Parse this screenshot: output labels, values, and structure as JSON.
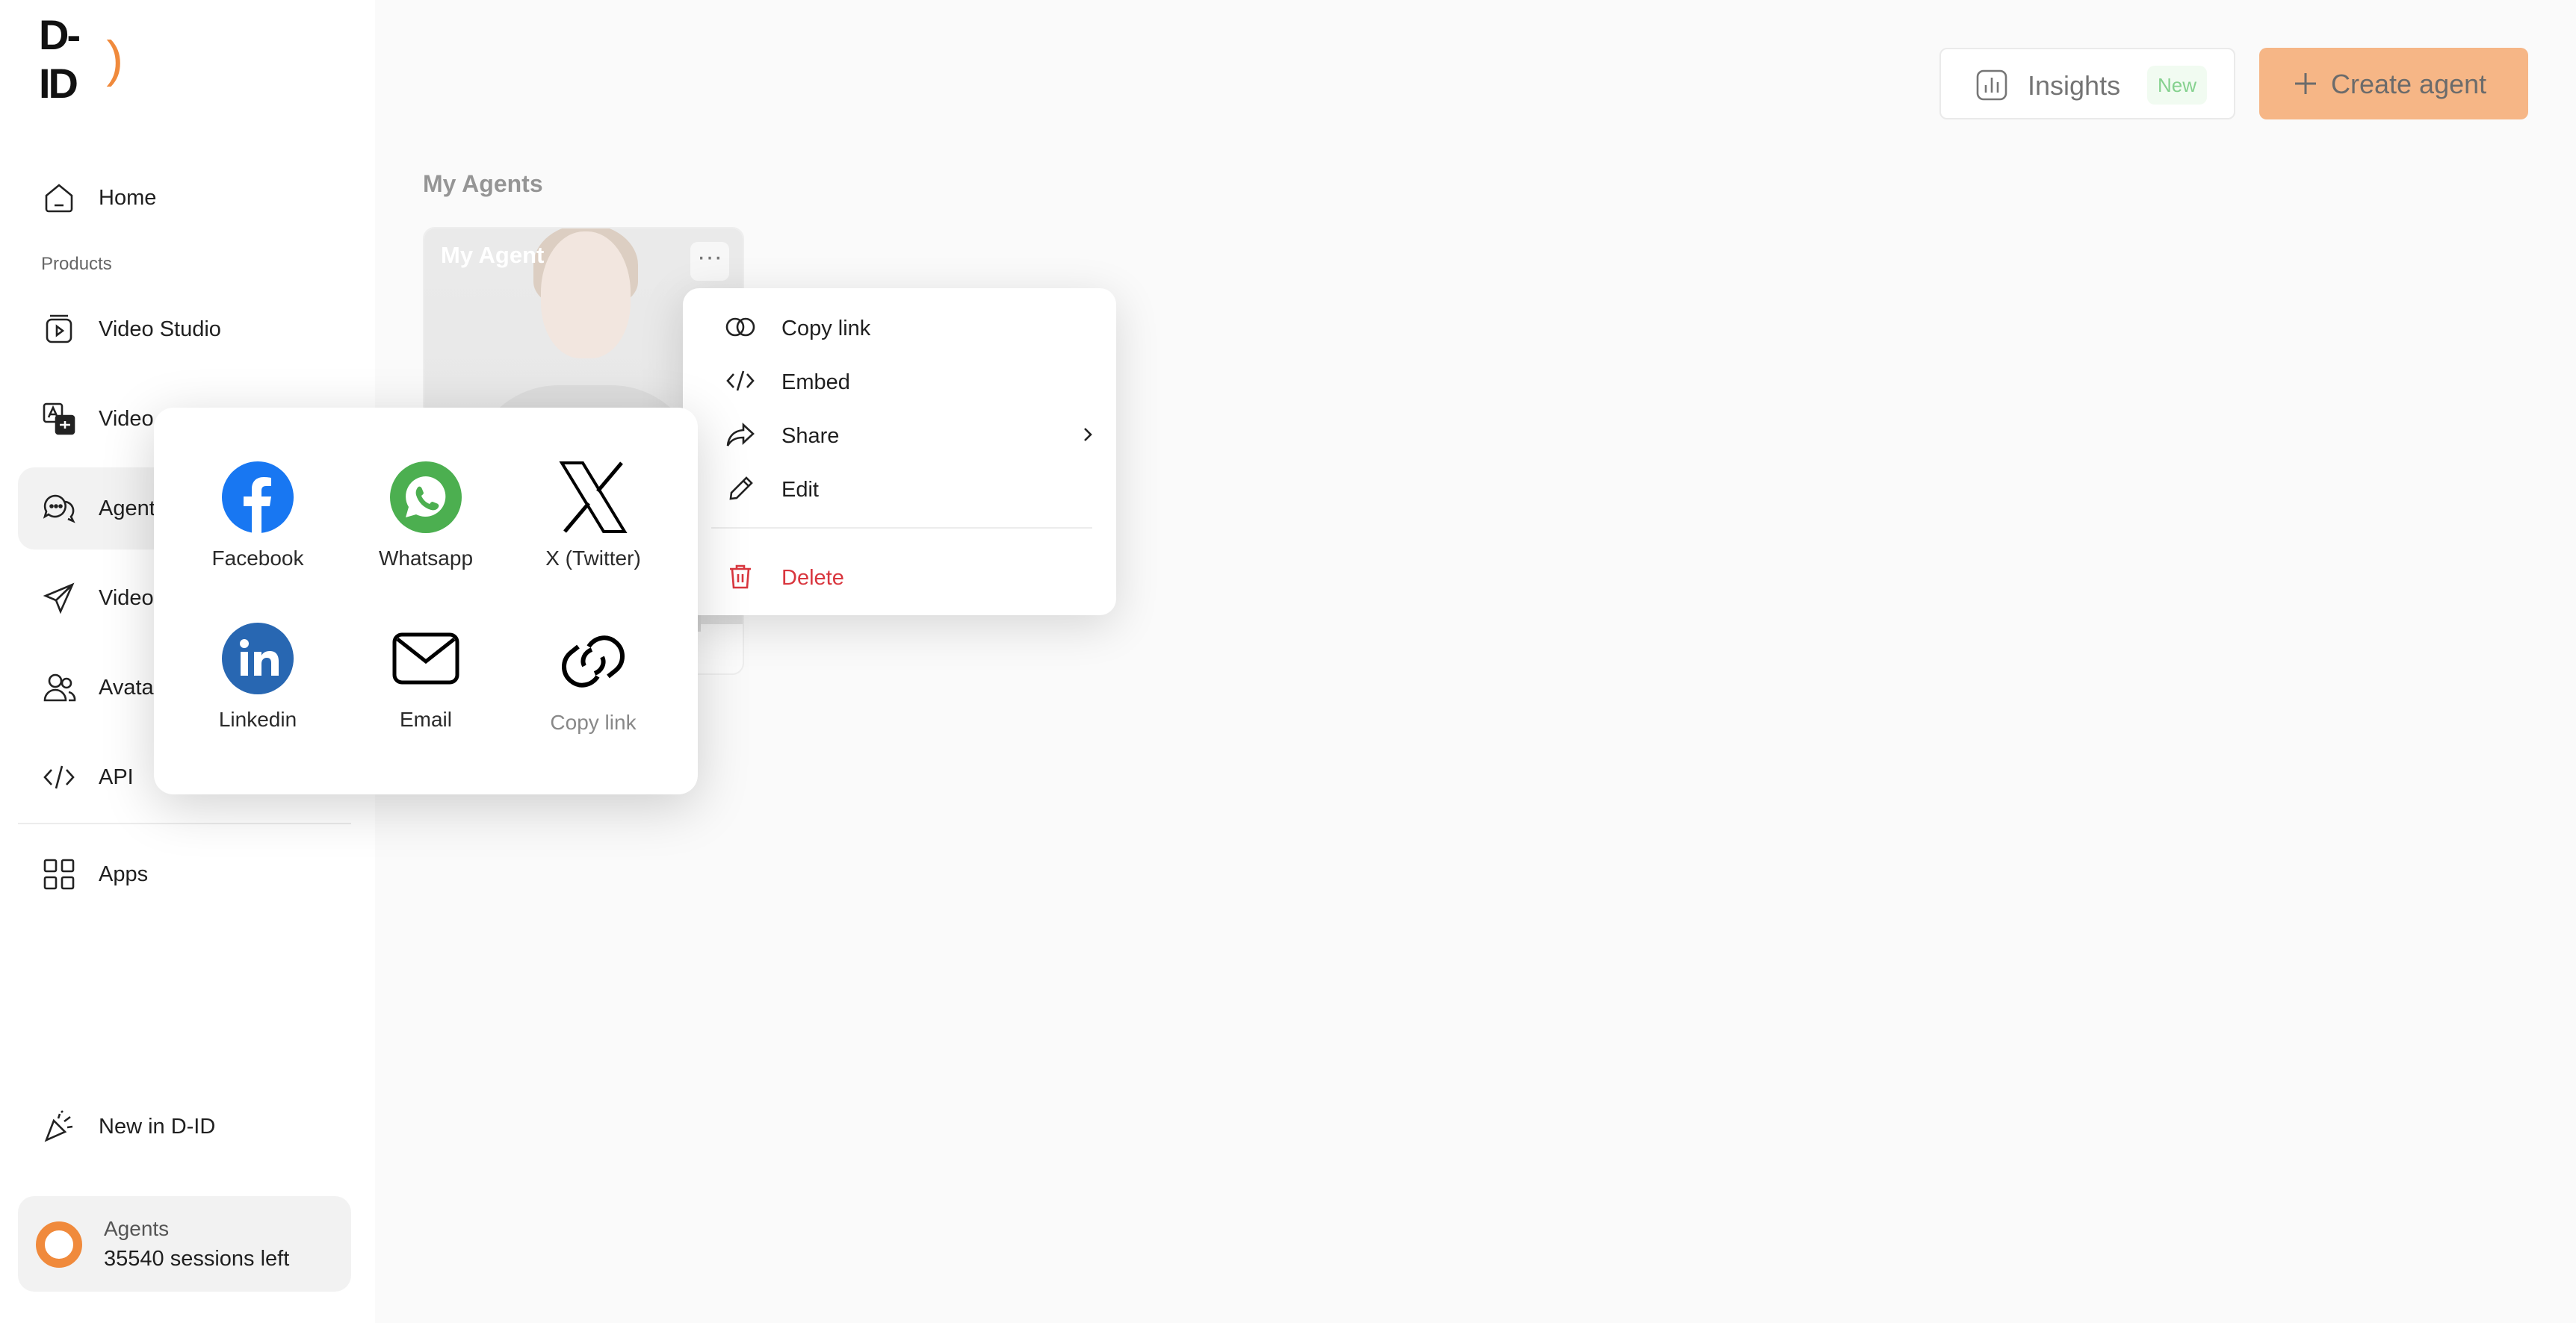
{
  "brand": {
    "logo_main": "D-ID",
    "logo_accent": ")",
    "accent_color": "#f08a3c"
  },
  "sidebar": {
    "home": "Home",
    "section_products": "Products",
    "items": [
      {
        "label": "Video Studio",
        "icon": "video-studio-icon"
      },
      {
        "label": "Video",
        "icon": "video-translate-icon"
      },
      {
        "label": "Agent",
        "icon": "agents-chat-icon"
      },
      {
        "label": "Video",
        "icon": "send-video-icon"
      },
      {
        "label": "Avata",
        "icon": "avatars-icon"
      },
      {
        "label": "API",
        "icon": "code-icon"
      }
    ],
    "apps": "Apps",
    "new_in": "New in D-ID",
    "usage": {
      "product": "Agents",
      "remaining": "35540 sessions left"
    }
  },
  "header": {
    "insights_label": "Insights",
    "insights_badge": "New",
    "create_label": "Create agent"
  },
  "main": {
    "title": "My Agents",
    "agent_card": {
      "name": "My Agent",
      "menu_glyph": "···"
    }
  },
  "context_menu": {
    "items": [
      {
        "label": "Copy link",
        "icon": "link-icon"
      },
      {
        "label": "Embed",
        "icon": "code-icon"
      },
      {
        "label": "Share",
        "icon": "share-arrow-icon"
      },
      {
        "label": "Edit",
        "icon": "pencil-icon"
      },
      {
        "label": "Delete",
        "icon": "trash-icon"
      }
    ]
  },
  "share_popup": {
    "items": [
      {
        "label": "Facebook",
        "color": "#1877f2"
      },
      {
        "label": "Whatsapp",
        "color": "#4caf50"
      },
      {
        "label": "X (Twitter)",
        "color": "#000000"
      },
      {
        "label": "Linkedin",
        "color": "#2867b2"
      },
      {
        "label": "Email",
        "color": "#000000"
      },
      {
        "label": "Copy link",
        "color": "#000000"
      }
    ]
  }
}
